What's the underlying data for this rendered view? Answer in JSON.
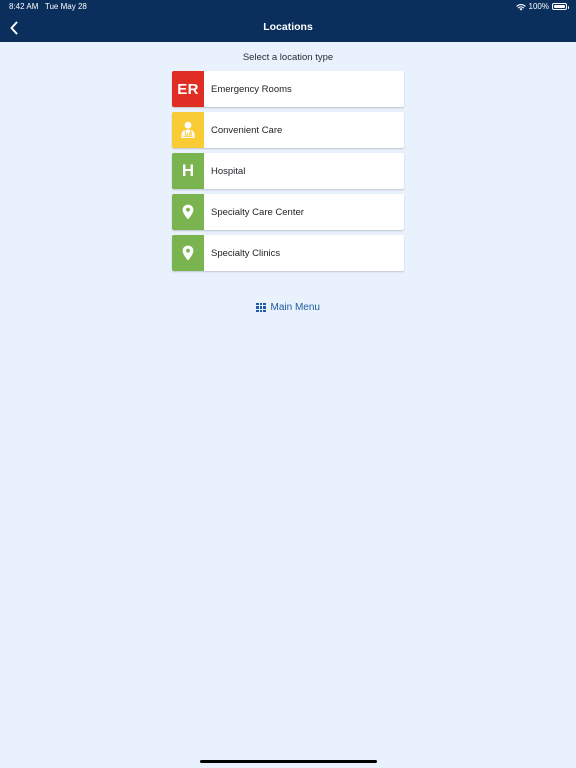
{
  "status_bar": {
    "time": "8:42 AM",
    "date": "Tue May 28",
    "battery_percent": "100%",
    "battery_level": 1.0,
    "wifi_icon": "wifi-icon",
    "battery_icon": "battery-icon"
  },
  "nav": {
    "title": "Locations",
    "back_icon": "chevron-left-icon"
  },
  "heading": "Select a location type",
  "locations": [
    {
      "label": "Emergency Rooms",
      "icon_text": "ER",
      "icon": "er-text-icon",
      "color": "#e02e24"
    },
    {
      "label": "Convenient Care",
      "icon_text": "",
      "icon": "doctor-icon",
      "color": "#f9cb35"
    },
    {
      "label": "Hospital",
      "icon_text": "H",
      "icon": "h-text-icon",
      "color": "#7ab44e"
    },
    {
      "label": "Specialty Care Center",
      "icon_text": "",
      "icon": "map-pin-icon",
      "color": "#7ab44e"
    },
    {
      "label": "Specialty Clinics",
      "icon_text": "",
      "icon": "map-pin-icon",
      "color": "#7ab44e"
    }
  ],
  "main_menu": {
    "label": "Main Menu",
    "icon": "grid-icon",
    "color": "#1f5ca1"
  },
  "colors": {
    "nav_background": "#0a2f5c",
    "page_background": "#e9f1fc"
  }
}
